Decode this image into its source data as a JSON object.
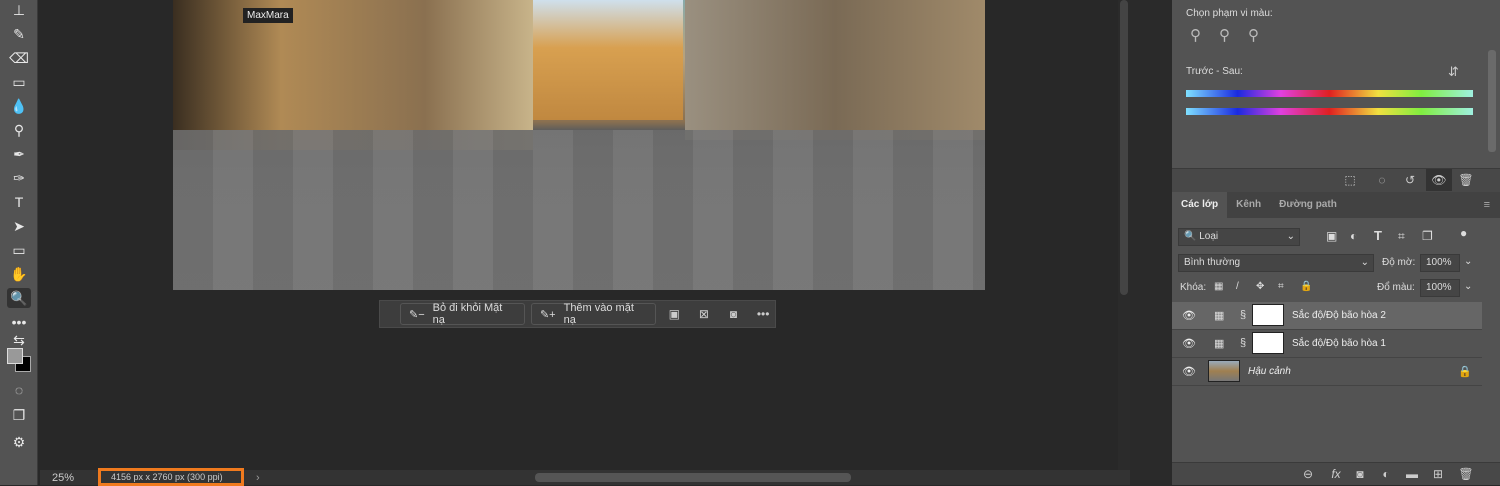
{
  "toolbar": {
    "tools": [
      {
        "name": "stamp-icon",
        "glyph": "⊥"
      },
      {
        "name": "history-brush-icon",
        "glyph": "✎"
      },
      {
        "name": "eraser-icon",
        "glyph": "⌫"
      },
      {
        "name": "gradient-icon",
        "glyph": "▭"
      },
      {
        "name": "blur-icon",
        "glyph": "💧"
      },
      {
        "name": "dodge-icon",
        "glyph": "⚲"
      },
      {
        "name": "pen-icon",
        "glyph": "✒"
      },
      {
        "name": "pen-tool-icon",
        "glyph": "✑"
      },
      {
        "name": "type-icon",
        "glyph": "T"
      },
      {
        "name": "path-select-icon",
        "glyph": "➤"
      },
      {
        "name": "rectangle-icon",
        "glyph": "▭"
      },
      {
        "name": "hand-icon",
        "glyph": "✋"
      },
      {
        "name": "zoom-icon",
        "glyph": "🔍"
      },
      {
        "name": "more-tools-icon",
        "glyph": "•••"
      }
    ]
  },
  "photo": {
    "sign": "MaxMara"
  },
  "context_bar": {
    "subtract": "Bỏ đi khỏi Mặt nạ",
    "add": "Thêm vào mặt nạ"
  },
  "status": {
    "zoom": "25%",
    "doc_info": "4156 px x 2760 px (300 ppi)"
  },
  "properties": {
    "color_range_label": "Chọn phạm vi màu:",
    "before_after_label": "Trước - Sau:"
  },
  "layers_panel": {
    "tabs": [
      "Các lớp",
      "Kênh",
      "Đường path"
    ],
    "filter": "Loại",
    "blend_mode": "Bình thường",
    "opacity_label": "Độ mờ:",
    "opacity": "100%",
    "lock_label": "Khóa:",
    "fill_label": "Đổ màu:",
    "fill": "100%",
    "layers": [
      {
        "name": "Sắc độ/Độ bão hòa 2",
        "selected": true
      },
      {
        "name": "Sắc độ/Độ bão hòa 1",
        "selected": false
      },
      {
        "name": "Hậu cảnh",
        "selected": false
      }
    ]
  }
}
